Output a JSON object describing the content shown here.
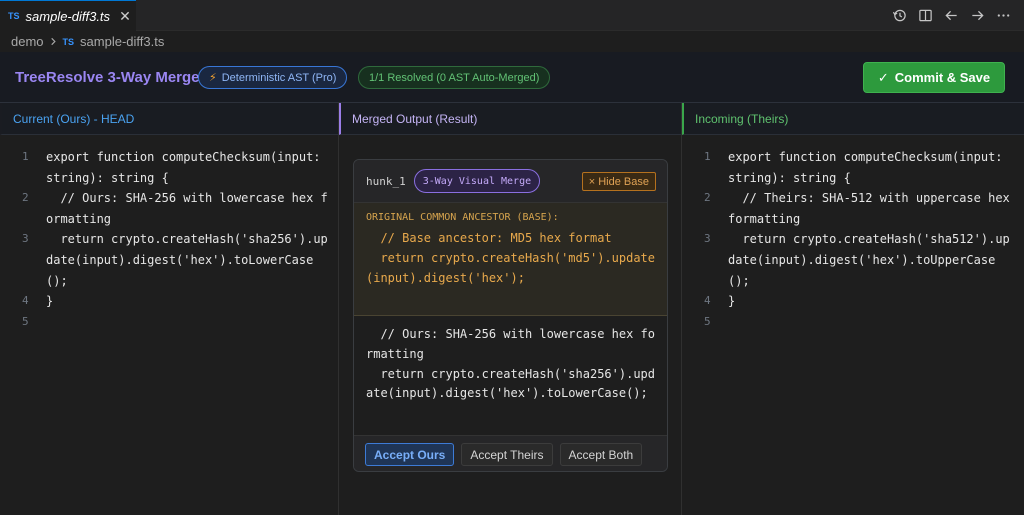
{
  "tab": {
    "lang": "TS",
    "filename": "sample-diff3.ts",
    "close": "✕"
  },
  "toolbar_icons": [
    "history-icon",
    "split-editor-icon",
    "arrow-left-icon",
    "arrow-right-icon",
    "more-icon"
  ],
  "breadcrumb": {
    "folder": "demo",
    "lang": "TS",
    "file": "sample-diff3.ts"
  },
  "header": {
    "title": "TreeResolve 3-Way Merge",
    "badge_ast": "Deterministic AST (Pro)",
    "badge_resolved": "1/1 Resolved (0 AST Auto-Merged)",
    "commit_label": "Commit & Save"
  },
  "colors": {
    "accent_purple": "#9a86f2",
    "ours_blue": "#4aa3f2",
    "theirs_green": "#5fc26f",
    "base_orange": "#e8a94c",
    "commit_green": "#2d9a3d"
  },
  "left": {
    "title": "Current (Ours) - HEAD",
    "lines": [
      {
        "n": "1",
        "text": "export function computeChecksum(input: string): string {"
      },
      {
        "n": "2",
        "text": "  // Ours: SHA-256 with lowercase hex formatting"
      },
      {
        "n": "3",
        "text": "  return crypto.createHash('sha256').update(input).digest('hex').toLowerCase();"
      },
      {
        "n": "4",
        "text": "}"
      },
      {
        "n": "5",
        "text": ""
      }
    ]
  },
  "middle": {
    "title": "Merged Output (Result)",
    "hunk": {
      "name": "hunk_1",
      "badge": "3-Way Visual Merge",
      "hide_base": "Hide Base",
      "base_label": "ORIGINAL COMMON ANCESTOR (BASE):",
      "base_lines": [
        "  // Base ancestor: MD5 hex format",
        "  return crypto.createHash('md5').update(input).digest('hex');"
      ],
      "ours_lines": [
        "  // Ours: SHA-256 with lowercase hex formatting",
        "  return crypto.createHash('sha256').update(input).digest('hex').toLowerCase();"
      ],
      "buttons": {
        "accept_ours": "Accept Ours",
        "accept_theirs": "Accept Theirs",
        "accept_both": "Accept Both"
      }
    }
  },
  "right": {
    "title": "Incoming (Theirs)",
    "lines": [
      {
        "n": "1",
        "text": "export function computeChecksum(input: string): string {"
      },
      {
        "n": "2",
        "text": "  // Theirs: SHA-512 with uppercase hex formatting"
      },
      {
        "n": "3",
        "text": "  return crypto.createHash('sha512').update(input).digest('hex').toUpperCase();"
      },
      {
        "n": "4",
        "text": "}"
      },
      {
        "n": "5",
        "text": ""
      }
    ]
  }
}
